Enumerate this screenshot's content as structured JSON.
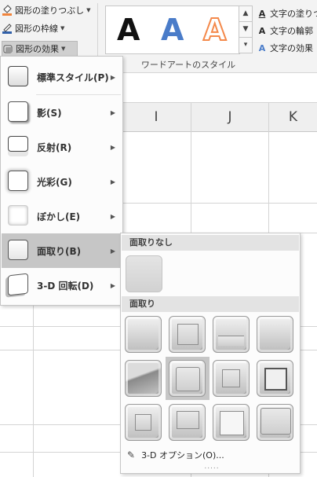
{
  "ribbon": {
    "shape_fill": "図形の塗りつぶし",
    "shape_outline": "図形の枠線",
    "shape_effect": "図形の効果",
    "wordart_samples": [
      "A",
      "A",
      "A"
    ],
    "text_fill": "文字の塗りつぶ",
    "text_outline": "文字の輪郭",
    "text_effect": "文字の効果",
    "group_label": "ワードアートのスタイル"
  },
  "sheet": {
    "columns": [
      "I",
      "J",
      "K"
    ]
  },
  "effect_menu": {
    "items": [
      {
        "label": "標準スタイル(P)",
        "key": "P"
      },
      {
        "label": "影(S)",
        "key": "S"
      },
      {
        "label": "反射(R)",
        "key": "R"
      },
      {
        "label": "光彩(G)",
        "key": "G"
      },
      {
        "label": "ぼかし(E)",
        "key": "E"
      },
      {
        "label": "面取り(B)",
        "key": "B"
      },
      {
        "label": "3-D 回転(D)",
        "key": "D"
      }
    ]
  },
  "bevel_menu": {
    "no_bevel_header": "面取りなし",
    "bevel_header": "面取り",
    "options": "3-D オプション(O)...",
    "grip": "....."
  },
  "colors": {
    "ribbon_bg": "#f3f3f3",
    "menu_active": "#c6c6c6",
    "section_header": "#e3e3e3",
    "wordart_blue": "#4a7cc9",
    "wordart_orange": "#f4894b"
  },
  "icons": [
    "paint-bucket-icon",
    "outline-pen-icon",
    "shape-effect-icon",
    "text-fill-icon",
    "text-outline-icon",
    "text-effect-icon",
    "submenu-arrow-icon",
    "3d-options-icon"
  ]
}
